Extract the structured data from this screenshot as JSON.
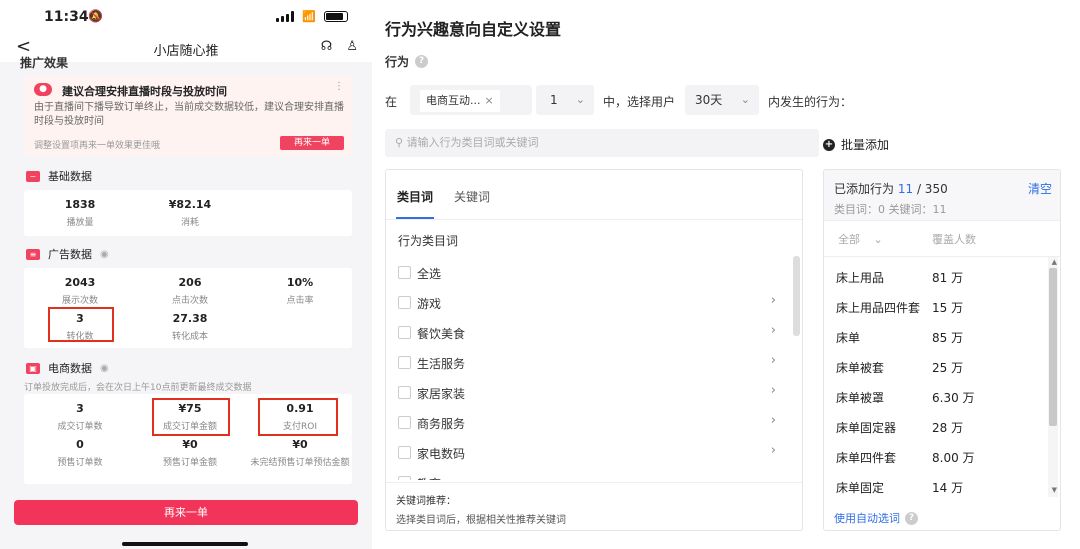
{
  "phone": {
    "status": {
      "time": "11:34"
    },
    "nav": {
      "back": "<",
      "title": "小店随心推"
    },
    "effect_title": "推广效果",
    "tip": {
      "title": "建议合理安排直播时段与投放时间",
      "body": "由于直播间下播导致订单终止，当前成交数据较低，建议合理安排直播时段与投放时间",
      "footer": "调整设置项再来一单效果更佳哦",
      "button": "再来一单"
    },
    "basic": {
      "title": "基础数据",
      "stats": [
        {
          "value": "1838",
          "label": "播放量"
        },
        {
          "value": "¥82.14",
          "label": "消耗"
        }
      ]
    },
    "ads": {
      "title": "广告数据",
      "stats": [
        {
          "value": "2043",
          "label": "展示次数"
        },
        {
          "value": "206",
          "label": "点击次数"
        },
        {
          "value": "10%",
          "label": "点击率"
        },
        {
          "value": "3",
          "label": "转化数"
        },
        {
          "value": "27.38",
          "label": "转化成本"
        }
      ]
    },
    "ecommerce": {
      "title": "电商数据",
      "note": "订单投放完成后，会在次日上午10点前更新最终成交数据",
      "stats": [
        {
          "value": "3",
          "label": "成交订单数"
        },
        {
          "value": "¥75",
          "label": "成交订单金额"
        },
        {
          "value": "0.91",
          "label": "支付ROI"
        },
        {
          "value": "0",
          "label": "预售订单数"
        },
        {
          "value": "¥0",
          "label": "预售订单金额"
        },
        {
          "value": "¥0",
          "label": "未完结预售订单预估金额"
        }
      ]
    },
    "bottom_button": "再来一单"
  },
  "settings": {
    "title": "行为兴趣意向自定义设置",
    "behavior_label": "行为",
    "row": {
      "prefix": "在",
      "tag": "电商互动...",
      "count": "1",
      "mid": "中，选择用户",
      "days": "30天",
      "suffix": "内发生的行为："
    },
    "search_placeholder": "请输入行为类目词或关键词",
    "bulk_add": "批量添加",
    "tabs": [
      "类目词",
      "关键词"
    ],
    "column_header": "行为类目词",
    "categories": [
      {
        "label": "全选",
        "arrow": false
      },
      {
        "label": "游戏",
        "arrow": true
      },
      {
        "label": "餐饮美食",
        "arrow": true
      },
      {
        "label": "生活服务",
        "arrow": true
      },
      {
        "label": "家居家装",
        "arrow": true
      },
      {
        "label": "商务服务",
        "arrow": true
      },
      {
        "label": "家电数码",
        "arrow": true
      },
      {
        "label": "教育",
        "arrow": true
      }
    ],
    "keyword_title": "关键词推荐：",
    "keyword_desc": "选择类目词后，根据相关性推荐关键词",
    "added": {
      "prefix": "已添加行为",
      "count": "11",
      "total": "/ 350",
      "clear": "清空",
      "sub": "类目词：0   关键词：11",
      "filter_all": "全部",
      "filter_coverage": "覆盖人数",
      "rows": [
        {
          "name": "床上用品",
          "value": "81 万"
        },
        {
          "name": "床上用品四件套",
          "value": "15 万"
        },
        {
          "name": "床单",
          "value": "85 万"
        },
        {
          "name": "床单被套",
          "value": "25 万"
        },
        {
          "name": "床单被罩",
          "value": "6.30 万"
        },
        {
          "name": "床单固定器",
          "value": "28 万"
        },
        {
          "name": "床单四件套",
          "value": "8.00 万"
        },
        {
          "name": "床单固定",
          "value": "14 万"
        }
      ],
      "auto_select": "使用自动选词"
    }
  }
}
